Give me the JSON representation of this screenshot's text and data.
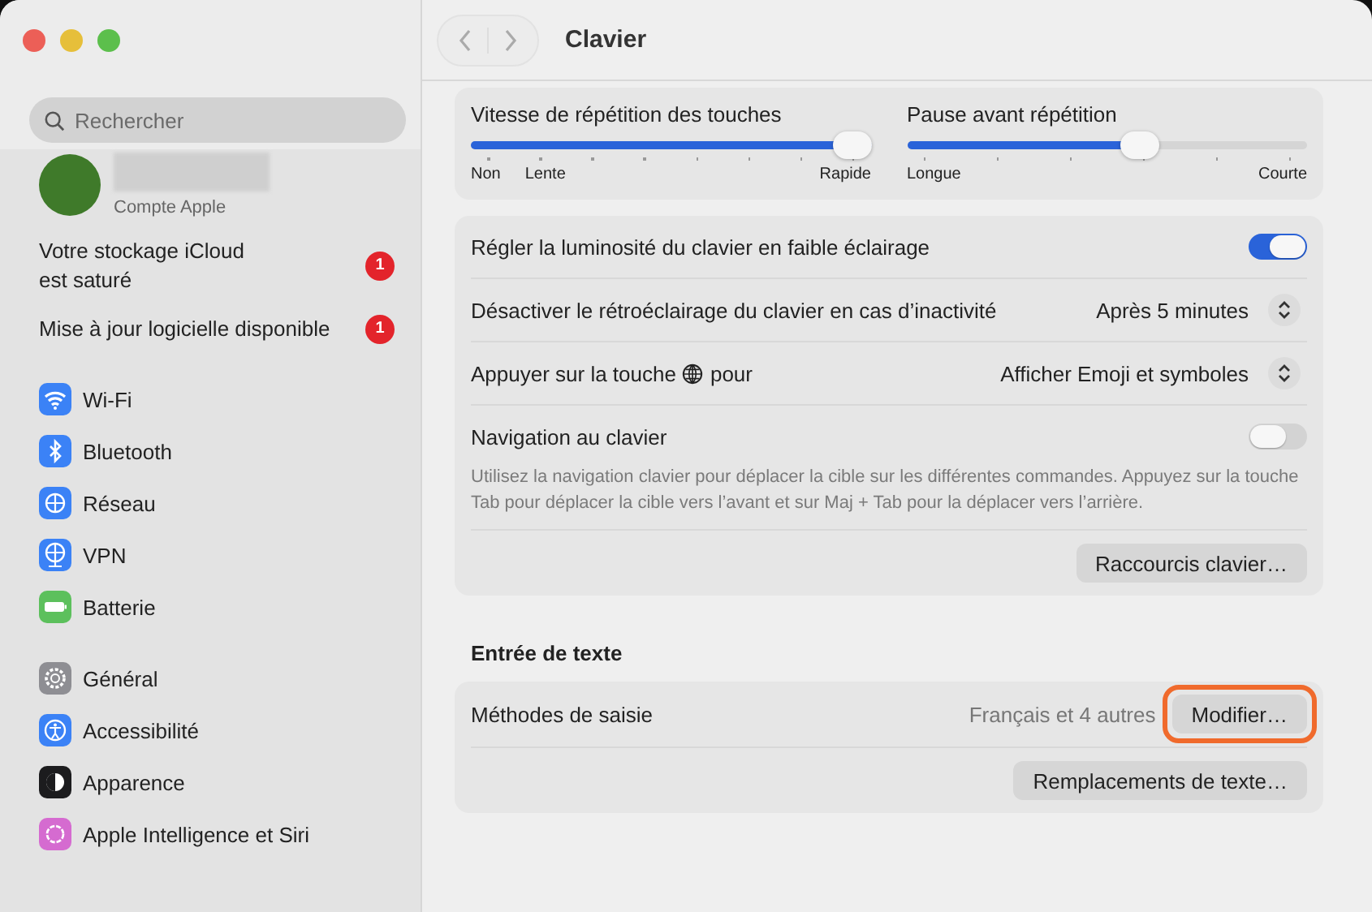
{
  "window": {
    "title": "Clavier"
  },
  "sidebar": {
    "search": {
      "placeholder": "Rechercher"
    },
    "account": {
      "subtitle": "Compte Apple"
    },
    "notices": [
      {
        "label": "Votre stockage iCloud\nest saturé",
        "badge": "1"
      },
      {
        "label": "Mise à jour logicielle disponible",
        "badge": "1"
      }
    ],
    "groups": [
      [
        {
          "label": "Wi-Fi",
          "color": "#3b82f6"
        },
        {
          "label": "Bluetooth",
          "color": "#3b82f6"
        },
        {
          "label": "Réseau",
          "color": "#3b82f6"
        },
        {
          "label": "VPN",
          "color": "#3b82f6"
        },
        {
          "label": "Batterie",
          "color": "#5cc05c"
        }
      ],
      [
        {
          "label": "Général",
          "color": "#8e8e93"
        },
        {
          "label": "Accessibilité",
          "color": "#3b82f6"
        },
        {
          "label": "Apparence",
          "color": "#1c1c1e"
        },
        {
          "label": "Apple Intelligence et Siri",
          "color": "#d56bd0"
        }
      ]
    ]
  },
  "sliders": [
    {
      "label": "Vitesse de répétition des touches",
      "level": 1.0,
      "left_labels": [
        "Non",
        "Lente"
      ],
      "right_label": "Rapide"
    },
    {
      "label": "Pause avant répétition",
      "level": 0.59,
      "left_labels": [
        "Longue"
      ],
      "right_label": "Courte"
    }
  ],
  "settings": [
    {
      "kind": "toggle",
      "label": "Régler la luminosité du clavier en faible éclairage",
      "on": true
    },
    {
      "kind": "popup",
      "label": "Désactiver le rétroéclairage du clavier en cas d’inactivité",
      "value": "Après 5 minutes"
    },
    {
      "kind": "popup",
      "label_before": "Appuyer sur la touche",
      "label_after": "pour",
      "value": "Afficher Emoji et symboles"
    },
    {
      "kind": "toggle",
      "label": "Navigation au clavier",
      "on": false,
      "description": "Utilisez la navigation clavier pour déplacer la cible sur les différentes commandes. Appuyez sur la touche Tab pour déplacer la cible vers l’avant et sur Maj + Tab pour la déplacer vers l’arrière."
    },
    {
      "kind": "button",
      "button": "Raccourcis clavier…"
    }
  ],
  "text_input": {
    "heading": "Entrée de texte",
    "rows": [
      {
        "kind": "method",
        "label": "Méthodes de saisie",
        "value": "Français et 4 autres",
        "button": "Modifier…",
        "highlighted": true
      },
      {
        "kind": "button",
        "button": "Remplacements de texte…"
      }
    ]
  }
}
